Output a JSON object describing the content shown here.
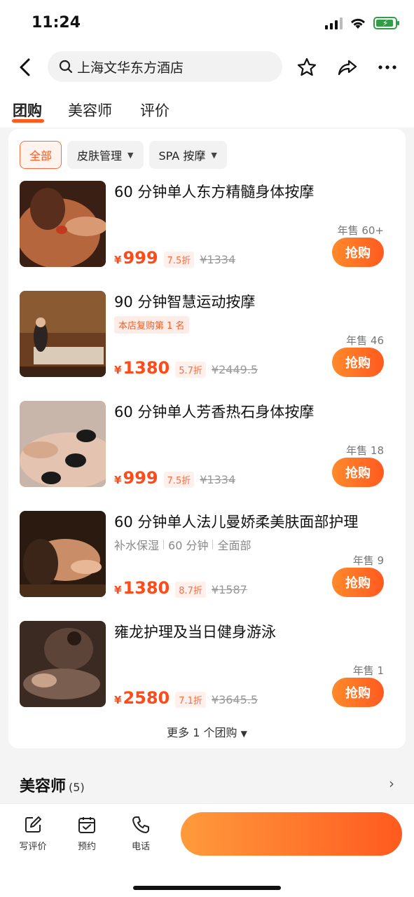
{
  "status": {
    "time": "11:24"
  },
  "search": {
    "query": "上海文华东方酒店"
  },
  "tabs": [
    {
      "label": "团购"
    },
    {
      "label": "美容师"
    },
    {
      "label": "评价"
    }
  ],
  "filters": [
    {
      "label": "全部"
    },
    {
      "label": "皮肤管理"
    },
    {
      "label": "SPA 按摩"
    }
  ],
  "deals": [
    {
      "title": "60 分钟单人东方精髓身体按摩",
      "price": "999",
      "discount": "7.5折",
      "original": "¥1334",
      "sold": "年售 60+",
      "buy": "抢购"
    },
    {
      "title": "90 分钟智慧运动按摩",
      "tag": "本店复购第 1 名",
      "price": "1380",
      "discount": "5.7折",
      "original": "¥2449.5",
      "sold": "年售 46",
      "buy": "抢购"
    },
    {
      "title": "60 分钟单人芳香热石身体按摩",
      "price": "999",
      "discount": "7.5折",
      "original": "¥1334",
      "sold": "年售 18",
      "buy": "抢购"
    },
    {
      "title": "60 分钟单人法儿曼娇柔美肤面部护理",
      "attrs": [
        "补水保湿",
        "60 分钟",
        "全面部"
      ],
      "price": "1380",
      "discount": "8.7折",
      "original": "¥1587",
      "sold": "年售 9",
      "buy": "抢购"
    },
    {
      "title": "雍龙护理及当日健身游泳",
      "price": "2580",
      "discount": "7.1折",
      "original": "¥3645.5",
      "sold": "年售 1",
      "buy": "抢购"
    }
  ],
  "currency": "¥",
  "more": "更多 1 个团购",
  "section": {
    "title": "美容师",
    "count": "(5)"
  },
  "bottom": [
    {
      "label": "写评价"
    },
    {
      "label": "预约"
    },
    {
      "label": "电话"
    }
  ]
}
